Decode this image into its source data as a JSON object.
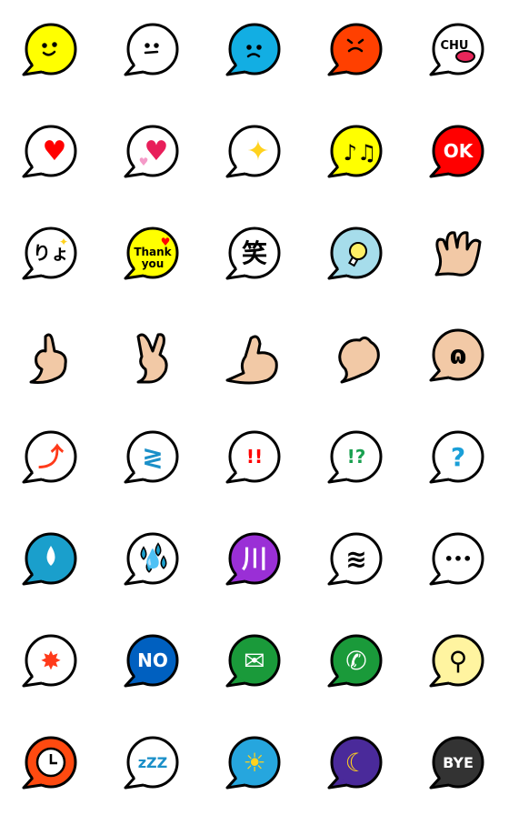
{
  "colors": {
    "outline": "#000000",
    "skin": "#F2C9A6"
  },
  "emojis": [
    {
      "name": "smile-face",
      "kind": "bubble",
      "fill": "#FFFF00",
      "face": "smile"
    },
    {
      "name": "neutral-face",
      "kind": "bubble",
      "fill": "#FFFFFF",
      "face": "neutral"
    },
    {
      "name": "sad-face",
      "kind": "bubble",
      "fill": "#12AEE3",
      "face": "sad"
    },
    {
      "name": "angry-face",
      "kind": "bubble",
      "fill": "#FF4000",
      "face": "angry"
    },
    {
      "name": "chu-kiss",
      "kind": "bubble",
      "fill": "#FFFFFF",
      "label": "CHU",
      "label_color": "#000000",
      "glyph": "lips",
      "glyph_color": "#E8265A"
    },
    {
      "name": "heart",
      "kind": "bubble",
      "fill": "#FFFFFF",
      "glyph": "♥",
      "glyph_color": "#FF0000"
    },
    {
      "name": "two-hearts",
      "kind": "bubble",
      "fill": "#FFFFFF",
      "glyph": "♥",
      "glyph_color": "#E81E5A",
      "glyph2": "♥",
      "glyph2_color": "#F49AC8"
    },
    {
      "name": "sparkles",
      "kind": "bubble",
      "fill": "#FFFFFF",
      "glyph": "✦",
      "glyph_color": "#FFD21E"
    },
    {
      "name": "music-notes",
      "kind": "bubble",
      "fill": "#FFFF00",
      "glyph": "♪♫",
      "glyph_color": "#000000"
    },
    {
      "name": "ok",
      "kind": "bubble",
      "fill": "#FF0000",
      "label": "OK",
      "label_color": "#FFFFFF"
    },
    {
      "name": "ryo",
      "kind": "bubble",
      "fill": "#FFFFFF",
      "label": "りょ",
      "label_color": "#000000",
      "glyph2": "✦",
      "glyph2_color": "#FFD21E"
    },
    {
      "name": "thank-you",
      "kind": "bubble",
      "fill": "#FFFF00",
      "label": "Thank",
      "label2": "you",
      "label_color": "#000000",
      "glyph2": "♥",
      "glyph2_color": "#FF0000"
    },
    {
      "name": "laugh",
      "kind": "bubble",
      "fill": "#FFFFFF",
      "label": "笑",
      "label_color": "#000000"
    },
    {
      "name": "light-bulb",
      "kind": "bubble",
      "fill": "#A6DDEB",
      "glyph": "bulb",
      "glyph_color": "#FFF066"
    },
    {
      "name": "open-hand",
      "kind": "hand",
      "fill": "#F2C9A6"
    },
    {
      "name": "thumbs-up",
      "kind": "hand",
      "fill": "#F2C9A6"
    },
    {
      "name": "peace-hand",
      "kind": "hand",
      "fill": "#F2C9A6"
    },
    {
      "name": "thumbs-up-side",
      "kind": "hand",
      "fill": "#F2C9A6"
    },
    {
      "name": "ok-hand",
      "kind": "hand",
      "fill": "#F2C9A6"
    },
    {
      "name": "skin-bubble",
      "kind": "bubble",
      "fill": "#F2C9A6",
      "label": "ɷ",
      "label_color": "#000000"
    },
    {
      "name": "up-arrows",
      "kind": "bubble",
      "fill": "#FFFFFF",
      "label": "⤴",
      "label_color": "#FF3A1A"
    },
    {
      "name": "zigzag-arrows",
      "kind": "bubble",
      "fill": "#FFFFFF",
      "label": "≷",
      "label_color": "#1A8FC8"
    },
    {
      "name": "double-exclamation",
      "kind": "bubble",
      "fill": "#FFFFFF",
      "label": "!!",
      "label_color": "#FF0000"
    },
    {
      "name": "exclamation-question",
      "kind": "bubble",
      "fill": "#FFFFFF",
      "label": "!?",
      "label_color": "#1AA050"
    },
    {
      "name": "question",
      "kind": "bubble",
      "fill": "#FFFFFF",
      "label": "?",
      "label_color": "#1A9FD8"
    },
    {
      "name": "water-drop",
      "kind": "bubble",
      "fill": "#1A9FCC",
      "glyph": "drop",
      "glyph_color": "#FFFFFF"
    },
    {
      "name": "sweat-drops",
      "kind": "bubble",
      "fill": "#FFFFFF",
      "label": "💧",
      "glyph": "drops",
      "glyph_color": "#1A9FCC"
    },
    {
      "name": "purple-lines",
      "kind": "bubble",
      "fill": "#9A2FD6",
      "label": "川",
      "label_color": "#FFFFFF"
    },
    {
      "name": "whirlwind",
      "kind": "bubble",
      "fill": "#FFFFFF",
      "label": "≋",
      "label_color": "#000000"
    },
    {
      "name": "ellipsis",
      "kind": "bubble",
      "fill": "#FFFFFF",
      "label": "•••",
      "label_color": "#000000"
    },
    {
      "name": "anger-mark",
      "kind": "bubble",
      "fill": "#FFFFFF",
      "label": "✸",
      "label_color": "#FF3A1A"
    },
    {
      "name": "no",
      "kind": "bubble",
      "fill": "#0060C0",
      "label": "NO",
      "label_color": "#FFFFFF"
    },
    {
      "name": "mail",
      "kind": "bubble",
      "fill": "#1A9A3A",
      "label": "✉",
      "label_color": "#FFFFFF"
    },
    {
      "name": "phone",
      "kind": "bubble",
      "fill": "#1A9A3A",
      "label": "✆",
      "label_color": "#FFFFFF"
    },
    {
      "name": "food",
      "kind": "bubble",
      "fill": "#FFF4A0",
      "label": "⚲",
      "label_color": "#000000"
    },
    {
      "name": "clock",
      "kind": "bubble",
      "fill": "#FF4A10",
      "glyph": "clock",
      "glyph_color": "#FFFFFF"
    },
    {
      "name": "sleep-zzz",
      "kind": "bubble",
      "fill": "#FFFFFF",
      "label": "zZZ",
      "label_color": "#1A8FC8"
    },
    {
      "name": "weather",
      "kind": "bubble",
      "fill": "#26A6DE",
      "label": "☀",
      "label_color": "#FFD21E"
    },
    {
      "name": "moon-stars",
      "kind": "bubble",
      "fill": "#4A2A9A",
      "label": "☾",
      "label_color": "#FFD21E"
    },
    {
      "name": "bye",
      "kind": "bubble",
      "fill": "#333333",
      "label": "BYE",
      "label_color": "#FFFFFF"
    }
  ]
}
